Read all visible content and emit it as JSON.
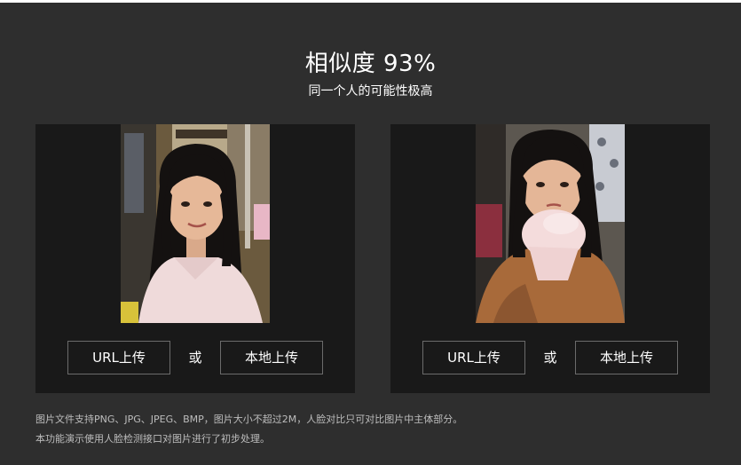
{
  "result": {
    "title": "相似度 93%",
    "subtitle": "同一个人的可能性极高"
  },
  "panels": [
    {
      "photo": "uploaded-face-photo-1",
      "url_button": "URL上传",
      "or_text": "或",
      "local_button": "本地上传"
    },
    {
      "photo": "uploaded-face-photo-2",
      "url_button": "URL上传",
      "or_text": "或",
      "local_button": "本地上传"
    }
  ],
  "notes": [
    "图片文件支持PNG、JPG、JPEG、BMP，图片大小不超过2M，人脸对比只可对比图片中主体部分。",
    "本功能演示使用人脸检测接口对图片进行了初步处理。"
  ],
  "colors": {
    "background": "#2e2e2e",
    "panel": "#191919",
    "button_border": "#6b6b6b",
    "text": "#ffffff",
    "note_text": "#bdbdbd"
  }
}
